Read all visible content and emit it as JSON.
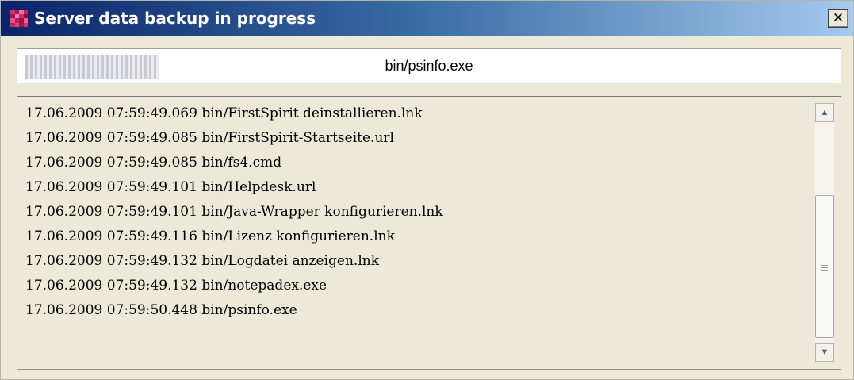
{
  "window": {
    "title": "Server data backup in progress",
    "close_glyph": "✕"
  },
  "colors": {
    "titlebar_start": "#0a246a",
    "titlebar_end": "#a6caf0",
    "window_bg": "#ece9d8",
    "progress_stripe": "#c9c9d2"
  },
  "icons": {
    "app": "firstspirit-app-icon",
    "close": "close-icon",
    "scroll_up": "arrow-up-icon",
    "scroll_down": "arrow-down-icon"
  },
  "progress": {
    "current_file": "bin/psinfo.exe",
    "fraction": 0.165
  },
  "log": {
    "lines": [
      "17.06.2009 07:59:49.069 bin/FirstSpirit deinstallieren.lnk",
      "17.06.2009 07:59:49.085 bin/FirstSpirit-Startseite.url",
      "17.06.2009 07:59:49.085 bin/fs4.cmd",
      "17.06.2009 07:59:49.101 bin/Helpdesk.url",
      "17.06.2009 07:59:49.101 bin/Java-Wrapper konfigurieren.lnk",
      "17.06.2009 07:59:49.116 bin/Lizenz konfigurieren.lnk",
      "17.06.2009 07:59:49.132 bin/Logdatei anzeigen.lnk",
      "17.06.2009 07:59:49.132 bin/notepadex.exe",
      "17.06.2009 07:59:50.448 bin/psinfo.exe"
    ]
  },
  "scrollbar": {
    "up_glyph": "▲",
    "down_glyph": "▼"
  }
}
